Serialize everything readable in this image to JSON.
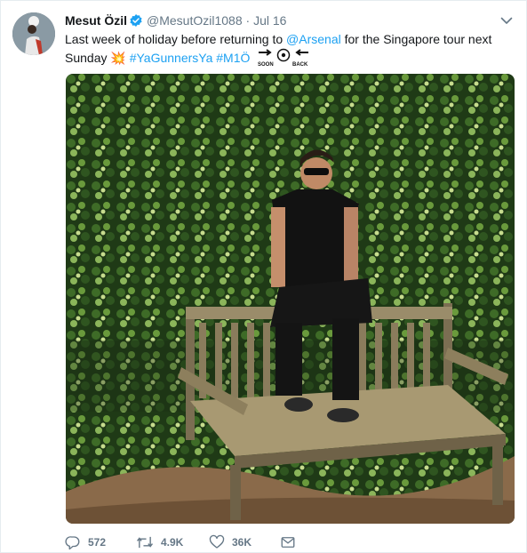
{
  "tweet": {
    "author_name": "Mesut Özil",
    "handle": "@MesutOzil1088",
    "separator": "·",
    "time": "Jul 16",
    "text_1": "Last week of holiday before returning to ",
    "mention": "@Arsenal",
    "text_2": " for the Singapore tour next Sunday ",
    "emoji": "💥",
    "hashtag_1": "#YaGunnersYa",
    "hashtag_2": "#M1Ö",
    "soon_label": "SOON",
    "back_label": "BACK"
  },
  "actions": {
    "reply_count": "572",
    "retweet_count": "4.9K",
    "like_count": "36K"
  },
  "colors": {
    "link": "#1da1f2",
    "secondary_text": "#657786",
    "verified": "#1da1f2"
  },
  "icons": [
    "verified-badge-icon",
    "chevron-down-icon",
    "reply-icon",
    "retweet-icon",
    "like-icon",
    "direct-message-icon"
  ]
}
